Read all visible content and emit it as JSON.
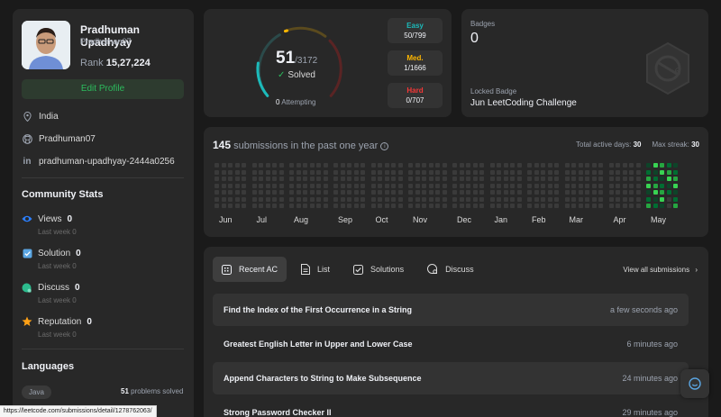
{
  "profile": {
    "name": "Pradhuman Upadhyay",
    "username": "Pradhuman07",
    "rank_label": "Rank",
    "rank_value": "15,27,224",
    "edit_label": "Edit Profile",
    "location": "India",
    "github": "Pradhuman07",
    "linkedin": "pradhuman-upadhyay-2444a0256"
  },
  "community": {
    "title": "Community Stats",
    "stats": [
      {
        "label": "Views",
        "value": "0",
        "sub_label": "Last week",
        "sub_value": "0",
        "color": "#2b7fff"
      },
      {
        "label": "Solution",
        "value": "0",
        "sub_label": "Last week",
        "sub_value": "0",
        "color": "#5ba6e3"
      },
      {
        "label": "Discuss",
        "value": "0",
        "sub_label": "Last week",
        "sub_value": "0",
        "color": "#2cbb8d"
      },
      {
        "label": "Reputation",
        "value": "0",
        "sub_label": "Last week",
        "sub_value": "0",
        "color": "#ffa116"
      }
    ]
  },
  "languages": {
    "title": "Languages",
    "items": [
      {
        "name": "Java",
        "count": "51",
        "suffix": "problems solved"
      }
    ]
  },
  "solved": {
    "count": "51",
    "total": "/3172",
    "label": "Solved",
    "attempting_count": "0",
    "attempting_label": "Attempting",
    "difficulties": [
      {
        "name": "Easy",
        "value": "50/799",
        "color": "#1cbaba"
      },
      {
        "name": "Med.",
        "value": "1/1666",
        "color": "#ffb700"
      },
      {
        "name": "Hard",
        "value": "0/707",
        "color": "#f63737"
      }
    ]
  },
  "badges": {
    "title": "Badges",
    "count": "0",
    "locked_label": "Locked Badge",
    "locked_name": "Jun LeetCoding Challenge"
  },
  "calendar": {
    "count": "145",
    "title_rest": "submissions in the past one year",
    "active_label": "Total active days:",
    "active_value": "30",
    "streak_label": "Max streak:",
    "streak_value": "30",
    "months": [
      "Jun",
      "Jul",
      "Aug",
      "Sep",
      "Oct",
      "Nov",
      "Dec",
      "Jan",
      "Feb",
      "Mar",
      "Apr",
      "May"
    ]
  },
  "recent": {
    "tabs": [
      "Recent AC",
      "List",
      "Solutions",
      "Discuss"
    ],
    "view_all": "View all submissions",
    "items": [
      {
        "title": "Find the Index of the First Occurrence in a String",
        "time": "a few seconds ago"
      },
      {
        "title": "Greatest English Letter in Upper and Lower Case",
        "time": "6 minutes ago"
      },
      {
        "title": "Append Characters to String to Make Subsequence",
        "time": "24 minutes ago"
      },
      {
        "title": "Strong Password Checker II",
        "time": "29 minutes ago"
      }
    ]
  },
  "status_url": "https://leetcode.com/submissions/detail/1278762063/"
}
